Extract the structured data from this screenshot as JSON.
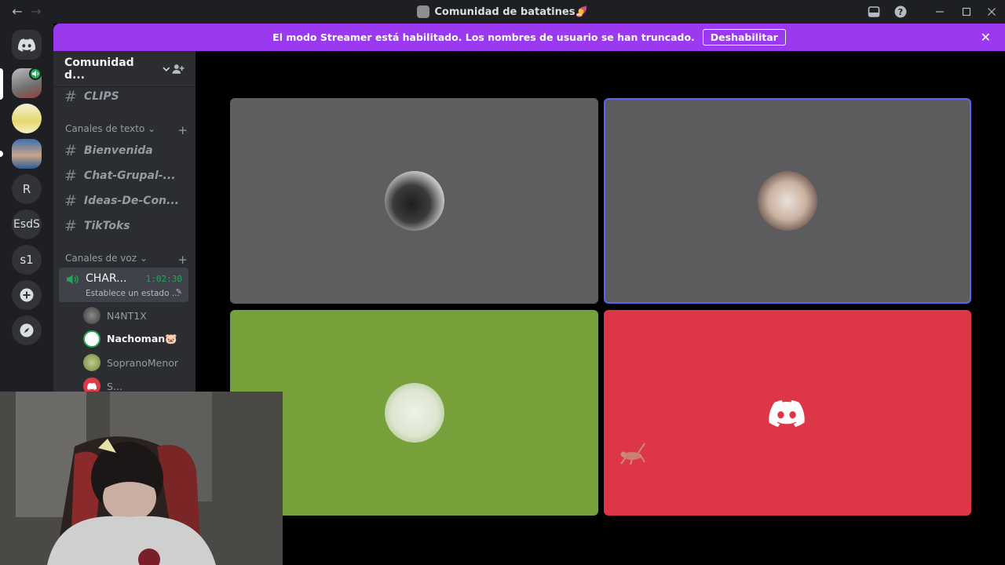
{
  "window": {
    "title": "Comunidad de batatines🍠",
    "back_icon": "arrow-left-icon",
    "forward_icon": "arrow-right-icon"
  },
  "banner": {
    "message": "El modo Streamer está habilitado. Los nombres de usuario se han truncado.",
    "button_label": "Deshabilitar",
    "color": "#9b39f0"
  },
  "rail": {
    "servers": [
      {
        "label": ""
      },
      {
        "label": ""
      },
      {
        "label": ""
      },
      {
        "label": "R"
      },
      {
        "label": "EsdS"
      },
      {
        "label": "s1"
      }
    ]
  },
  "sidebar": {
    "server_name": "Comunidad d...",
    "top_channel": "CLIPS",
    "text_category": "Canales de texto",
    "text_channels": [
      "Bienvenida",
      "Chat-Grupal-...",
      "Ideas-De-Con...",
      "TikToks"
    ],
    "voice_category": "Canales de voz",
    "voice_channel": {
      "name": "CHAR...",
      "timer": "1:02:30",
      "status": "Establece un estado ..."
    },
    "voice_users": [
      "N4NT1X",
      "Nachoman🐷",
      "SopranoMenor",
      "S..."
    ]
  },
  "video_tiles": [
    {
      "bg": "#5c5e5f",
      "speaking": false
    },
    {
      "bg": "#5c5c5f",
      "speaking": true
    },
    {
      "bg": "#77a03a",
      "speaking": false
    },
    {
      "bg": "#dd3647",
      "speaking": false
    }
  ],
  "colors": {
    "accent": "#5865f2",
    "online": "#23a55a"
  }
}
